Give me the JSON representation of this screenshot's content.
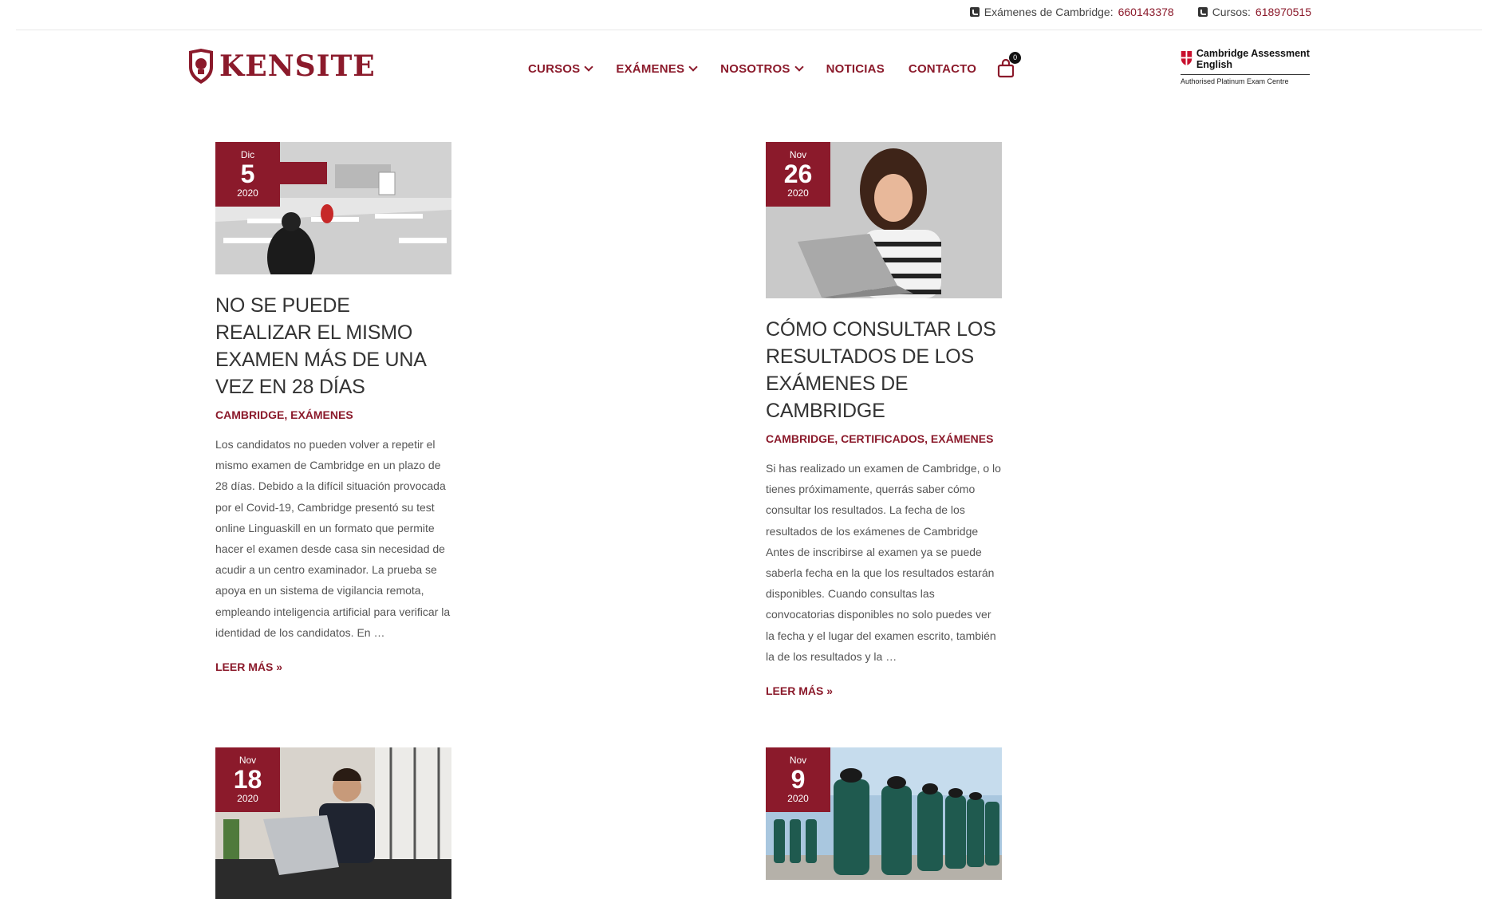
{
  "topbar": {
    "contacts": [
      {
        "label": "Exámenes de Cambridge:",
        "number": "660143378"
      },
      {
        "label": "Cursos:",
        "number": "618970515"
      }
    ]
  },
  "header": {
    "logo_text": "KENSITE",
    "nav": [
      {
        "label": "CURSOS",
        "dropdown": true
      },
      {
        "label": "EXÁMENES",
        "dropdown": true
      },
      {
        "label": "NOSOTROS",
        "dropdown": true
      },
      {
        "label": "NOTICIAS",
        "dropdown": false
      },
      {
        "label": "CONTACTO",
        "dropdown": false
      }
    ],
    "cart_count": "0",
    "cambridge": {
      "title": "Cambridge Assessment English",
      "subtitle": "Authorised Platinum Exam Centre"
    }
  },
  "posts": [
    {
      "month": "Dic",
      "day": "5",
      "year": "2020",
      "title": "NO SE PUEDE REALIZAR EL MISMO EXAMEN MÁS DE UNA VEZ EN 28 DÍAS",
      "categories": "CAMBRIDGE, EXÁMENES",
      "excerpt": "Los candidatos no pueden volver a repetir el mismo examen de Cambridge en un plazo de 28 días. Debido a la difícil situación provocada por el Covid-19, Cambridge presentó su test online Linguaskill en un formato que permite hacer el examen desde casa sin necesidad de acudir a un centro examinador. La prueba se apoya en un sistema de vigilancia remota, empleando inteligencia artificial para verificar la identidad de los candidatos. En …",
      "more": "LEER MÁS »"
    },
    {
      "month": "Nov",
      "day": "26",
      "year": "2020",
      "title": "CÓMO CONSULTAR LOS RESULTADOS DE LOS EXÁMENES DE CAMBRIDGE",
      "categories": "CAMBRIDGE, CERTIFICADOS, EXÁMENES",
      "excerpt": "Si has realizado un examen de Cambridge, o lo tienes próximamente, querrás saber cómo consultar los resultados. La fecha de los resultados de los exámenes de Cambridge Antes de inscribirse al examen ya se puede saberla fecha en la que los resultados estarán disponibles. Cuando consultas las convocatorias disponibles no solo puedes ver la fecha y el lugar del examen escrito, también la de los resultados y la …",
      "more": "LEER MÁS »"
    },
    {
      "month": "Nov",
      "day": "18",
      "year": "2020"
    },
    {
      "month": "Nov",
      "day": "9",
      "year": "2020"
    }
  ],
  "colors": {
    "brand": "#8b1a2b",
    "text": "#333333"
  }
}
